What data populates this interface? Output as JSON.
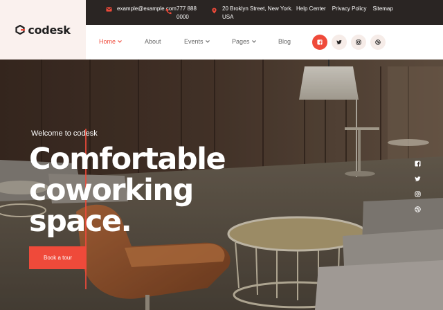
{
  "brand": {
    "name": "codesk"
  },
  "topbar": {
    "email": "example@example.com",
    "phone_line1": "777 888",
    "phone_line2": "0000",
    "address_line1": "20 Broklyn Street, New York.",
    "address_line2": "USA",
    "links": [
      "Help Center",
      "Privacy Policy",
      "Sitemap"
    ]
  },
  "nav": {
    "items": [
      {
        "label": "Home",
        "has_dropdown": true,
        "active": true
      },
      {
        "label": "About",
        "has_dropdown": false,
        "active": false
      },
      {
        "label": "Events",
        "has_dropdown": true,
        "active": false
      },
      {
        "label": "Pages",
        "has_dropdown": true,
        "active": false
      },
      {
        "label": "Blog",
        "has_dropdown": false,
        "active": false
      }
    ],
    "socials": [
      "facebook-icon",
      "twitter-icon",
      "instagram-icon",
      "dribbble-icon"
    ]
  },
  "hero": {
    "welcome": "Welcome to codesk",
    "headline_line1": "Comfortable",
    "headline_line2": "coworking",
    "headline_line3": "space.",
    "cta_label": "Book a tour",
    "side_socials": [
      "facebook-icon",
      "twitter-icon",
      "instagram-icon",
      "dribbble-icon"
    ]
  },
  "colors": {
    "accent": "#ef4a3a",
    "topbar_bg": "#2a2523",
    "logo_bg": "#faf1ee"
  }
}
